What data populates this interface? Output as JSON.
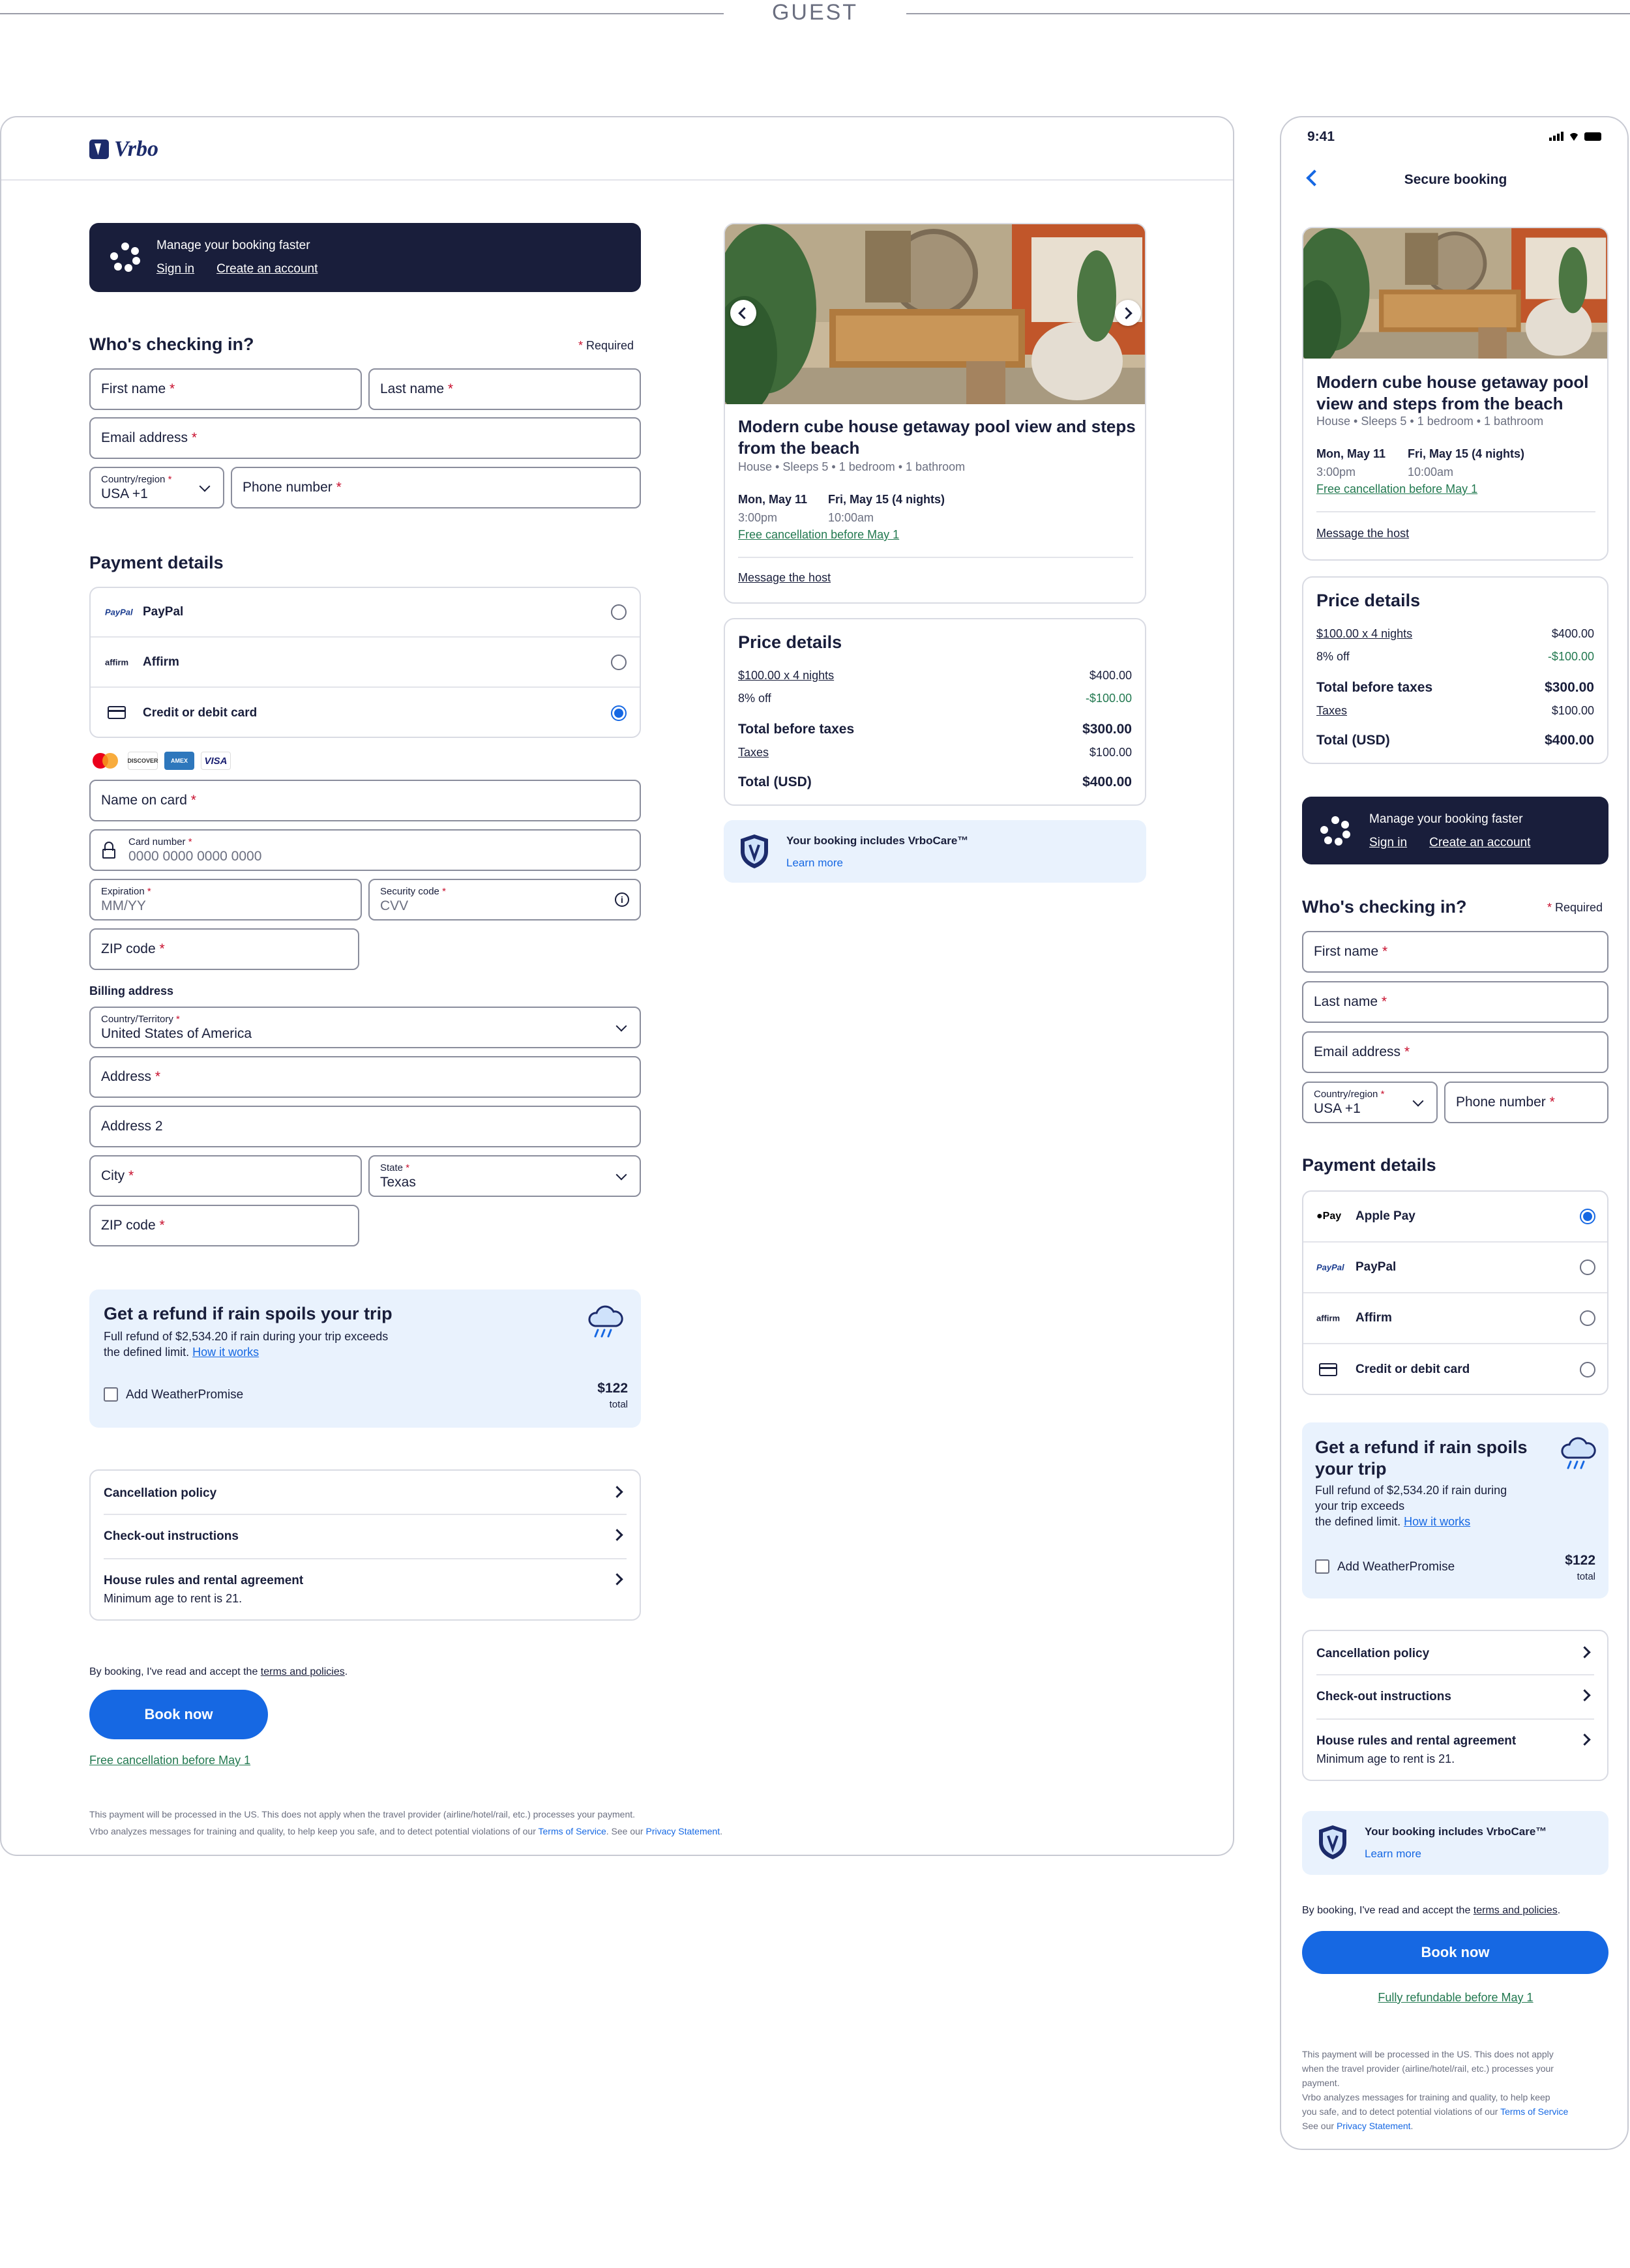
{
  "section_label": "GUEST",
  "brand": {
    "name": "Vrbo"
  },
  "colors": {
    "primary": "#1668e3",
    "navy": "#191e3b",
    "green_link": "#227950",
    "required": "#c8102e",
    "info_bg": "#e9f2fd"
  },
  "banner": {
    "title": "Manage your booking faster",
    "sign_in": "Sign in",
    "create_account": "Create an account",
    "icon": "flower-icon"
  },
  "checkin": {
    "title": "Who's checking in?",
    "required_note": "Required",
    "first_name": "First name",
    "last_name": "Last name",
    "email": "Email address",
    "country_label": "Country/region",
    "country_value": "USA +1",
    "phone": "Phone number"
  },
  "payment": {
    "title": "Payment details",
    "options": [
      {
        "label": "Apple Pay",
        "icon": "apple-pay-icon",
        "selected": true
      },
      {
        "label": "PayPal",
        "icon": "paypal-icon",
        "selected": false
      },
      {
        "label": "Affirm",
        "icon": "affirm-icon",
        "selected": false
      },
      {
        "label": "Credit or debit card",
        "icon": "credit-card-icon",
        "selected": false
      }
    ],
    "desktop_options": [
      {
        "label": "PayPal",
        "icon": "paypal-icon",
        "selected": false
      },
      {
        "label": "Affirm",
        "icon": "affirm-icon",
        "selected": false
      },
      {
        "label": "Credit or debit card",
        "icon": "credit-card-icon",
        "selected": true
      }
    ],
    "card_logos": [
      "mastercard-icon",
      "discover-icon",
      "amex-icon",
      "visa-icon"
    ],
    "name_on_card": "Name on card",
    "card_number_label": "Card number",
    "card_number_placeholder": "0000 0000 0000 0000",
    "expiration_label": "Expiration",
    "expiration_placeholder": "MM/YY",
    "security_label": "Security code",
    "security_placeholder": "CVV",
    "zip": "ZIP code"
  },
  "billing": {
    "title": "Billing address",
    "country_label": "Country/Territory",
    "country_value": "United States of America",
    "address": "Address",
    "address2": "Address 2",
    "city": "City",
    "state_label": "State",
    "state_value": "Texas",
    "zip": "ZIP code"
  },
  "weather": {
    "title": "Get a refund if rain spoils your trip",
    "desc_desktop_1": "Full refund of $2,534.20 if rain during your trip exceeds",
    "desc_desktop_2": "the defined limit.",
    "desc_mobile_1": "Full refund of $2,534.20 if rain during",
    "desc_mobile_2": "your trip exceeds",
    "desc_mobile_3": "the defined limit.",
    "how_it_works": "How it works",
    "checkbox": "Add WeatherPromise",
    "price": "$122",
    "price_note": "total"
  },
  "policies": [
    {
      "title": "Cancellation policy",
      "sub": ""
    },
    {
      "title": "Check-out instructions",
      "sub": ""
    },
    {
      "title": "House rules and rental agreement",
      "sub": "Minimum age to rent is 21."
    }
  ],
  "booking": {
    "terms_prefix": "By booking, I've read and accept the",
    "terms_link": "terms and policies",
    "button": "Book now",
    "free_cancel": "Free cancellation before May 1",
    "fully_refundable": "Fully refundable before May 1"
  },
  "footer": {
    "line1": "This payment will be processed in the US. This does not apply when the travel provider (airline/hotel/rail, etc.) processes your payment.",
    "line2_prefix": "Vrbo analyzes messages for training and quality, to help keep you safe, and to detect potential violations of our",
    "tos": "Terms of Service",
    "see": ". See our",
    "privacy": "Privacy Statement",
    "end": ".",
    "m1": "This payment will be processed in the US. This does not apply",
    "m2": "when the travel provider (airline/hotel/rail, etc.) processes your",
    "m3": "payment.",
    "m4": "Vrbo analyzes messages for training and quality, to help keep",
    "m5": "you safe, and to detect potential violations of our",
    "m6": "Service. See our"
  },
  "property": {
    "title_desktop_1": "Modern cube house getaway pool view and steps",
    "title_desktop_2": "from the beach",
    "title_mobile_1": "Modern cube house getaway pool",
    "title_mobile_2": "view and steps from the beach",
    "meta": "House • Sleeps 5 • 1 bedroom • 1 bathroom",
    "checkin_date": "Mon, May 11",
    "checkout_date": "Fri, May 15",
    "nights": "(4 nights)",
    "checkin_time": "3:00pm",
    "checkout_time": "10:00am",
    "free_cancel": "Free cancellation before May 1",
    "message_host": "Message the host"
  },
  "price": {
    "title": "Price details",
    "rows": [
      {
        "label": "$100.00 x 4 nights",
        "value": "$400.00"
      },
      {
        "label": "8% off",
        "value": "-$100.00"
      },
      {
        "label": "Total before taxes",
        "value": "$300.00"
      },
      {
        "label": "Taxes",
        "value": "$100.00"
      },
      {
        "label": "Total (USD)",
        "value": "$400.00"
      }
    ]
  },
  "vrbocare": {
    "title": "Your booking includes VrboCare™",
    "link": "Learn more",
    "icon": "shield-icon"
  },
  "mobile": {
    "time": "9:41",
    "title": "Secure booking"
  }
}
